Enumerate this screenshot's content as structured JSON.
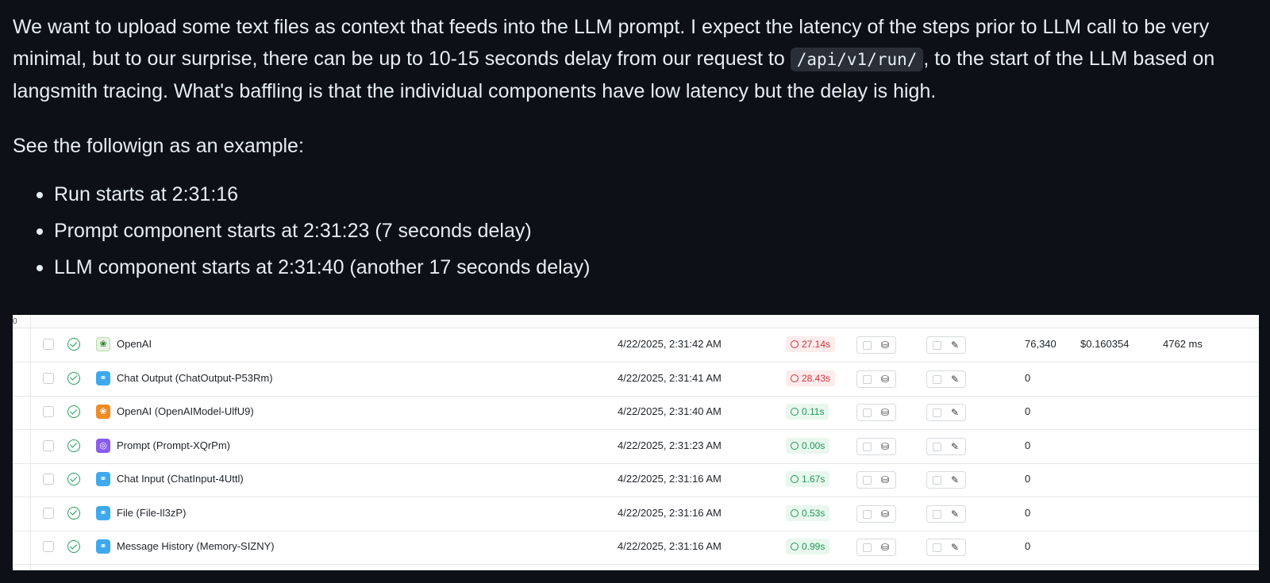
{
  "post": {
    "para1_a": "We want to upload some text files as context that feeds into the LLM prompt. I expect the latency of the steps prior to LLM call to be very minimal, but to our surprise, there can be up to 10-15 seconds delay from our request to ",
    "para1_code": "/api/v1/run/",
    "para1_b": ", to the start of the LLM based on langsmith tracing. What's baffling is that the individual components have low latency but the delay is high.",
    "para2": "See the followign as an example:",
    "bullets": [
      "Run starts at 2:31:16",
      "Prompt component starts at 2:31:23 (7 seconds delay)",
      "LLM component starts at 2:31:40 (another 17 seconds delay)"
    ]
  },
  "table": {
    "top_label": "0",
    "rows": [
      {
        "icon": "parrot-icon",
        "name": "OpenAI",
        "time": "4/22/2025, 2:31:42 AM",
        "latency": "27.14s",
        "latency_status": "red",
        "tokens": "76,340",
        "cost": "$0.160354",
        "first_token": "4762 ms"
      },
      {
        "icon": "link-icon",
        "name": "Chat Output (ChatOutput-P53Rm)",
        "time": "4/22/2025, 2:31:41 AM",
        "latency": "28.43s",
        "latency_status": "red",
        "tokens": "0",
        "cost": "",
        "first_token": ""
      },
      {
        "icon": "openai-icon",
        "name": "OpenAI (OpenAIModel-UlfU9)",
        "time": "4/22/2025, 2:31:40 AM",
        "latency": "0.11s",
        "latency_status": "green",
        "tokens": "0",
        "cost": "",
        "first_token": ""
      },
      {
        "icon": "prompt-icon",
        "name": "Prompt (Prompt-XQrPm)",
        "time": "4/22/2025, 2:31:23 AM",
        "latency": "0.00s",
        "latency_status": "green",
        "tokens": "0",
        "cost": "",
        "first_token": ""
      },
      {
        "icon": "link-icon",
        "name": "Chat Input (ChatInput-4Uttl)",
        "time": "4/22/2025, 2:31:16 AM",
        "latency": "1.67s",
        "latency_status": "green",
        "tokens": "0",
        "cost": "",
        "first_token": ""
      },
      {
        "icon": "link-icon",
        "name": "File (File-Il3zP)",
        "time": "4/22/2025, 2:31:16 AM",
        "latency": "0.53s",
        "latency_status": "green",
        "tokens": "0",
        "cost": "",
        "first_token": ""
      },
      {
        "icon": "link-icon",
        "name": "Message History (Memory-SIZNY)",
        "time": "4/22/2025, 2:31:16 AM",
        "latency": "0.99s",
        "latency_status": "green",
        "tokens": "0",
        "cost": "",
        "first_token": ""
      }
    ]
  },
  "colors": {
    "background": "#0d1117",
    "text": "#e6edf3",
    "latency_red": "#d0343b",
    "latency_green": "#1f9a57"
  }
}
